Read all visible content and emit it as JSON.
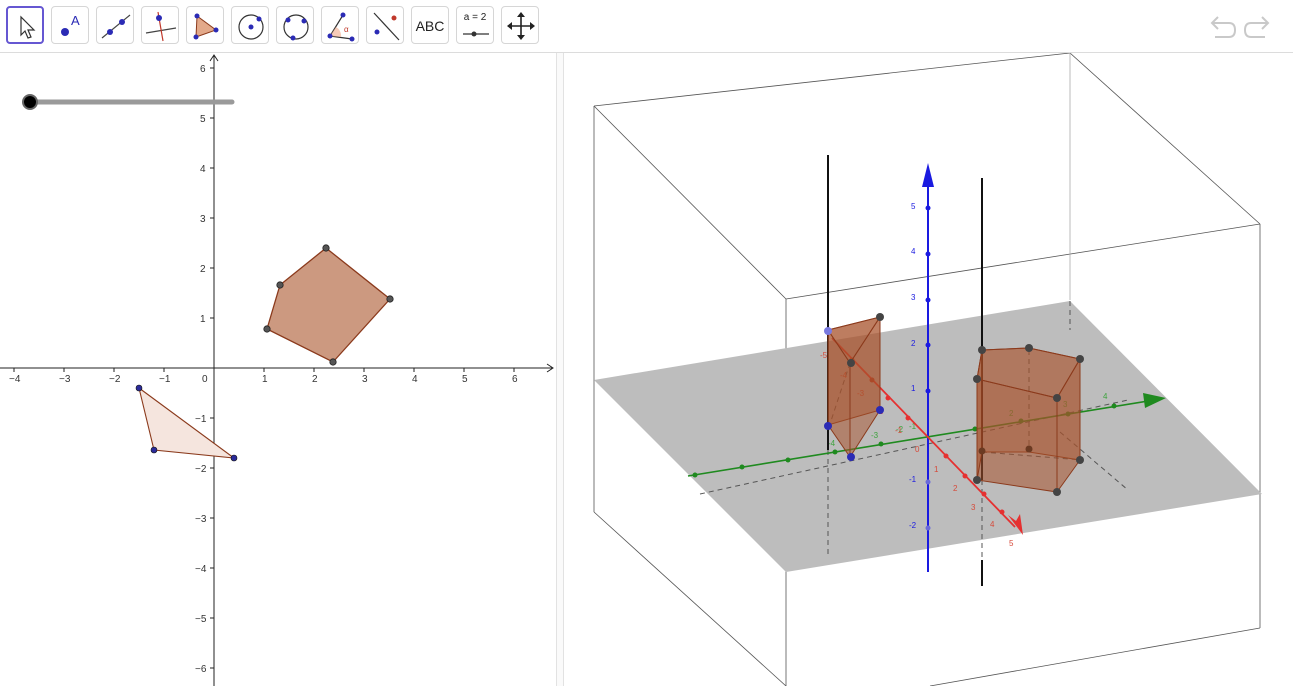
{
  "toolbar": {
    "tools": [
      {
        "name": "move-tool",
        "icon": "arrow-cursor-icon",
        "selected": true
      },
      {
        "name": "point-tool",
        "icon": "point-icon",
        "label": "A"
      },
      {
        "name": "line-tool",
        "icon": "line-through-two-points-icon"
      },
      {
        "name": "perpendicular-line-tool",
        "icon": "perpendicular-line-icon"
      },
      {
        "name": "polygon-tool",
        "icon": "polygon-icon"
      },
      {
        "name": "circle-center-point-tool",
        "icon": "circle-center-point-icon"
      },
      {
        "name": "circle-three-points-tool",
        "icon": "circle-three-points-icon"
      },
      {
        "name": "angle-tool",
        "icon": "angle-icon",
        "label": "α"
      },
      {
        "name": "reflect-about-line-tool",
        "icon": "reflect-about-line-icon"
      },
      {
        "name": "text-tool",
        "icon": "text-icon",
        "label": "ABC"
      },
      {
        "name": "slider-tool",
        "icon": "slider-icon",
        "label": "a = 2"
      },
      {
        "name": "move-graphics-view-tool",
        "icon": "move-graphics-view-icon"
      }
    ],
    "undo_icon": "undo-icon",
    "redo_icon": "redo-icon"
  },
  "graphics_2d": {
    "x_ticks": [
      "−4",
      "−3",
      "−2",
      "−1",
      "0",
      "1",
      "2",
      "3",
      "4",
      "5",
      "6"
    ],
    "y_ticks": [
      "6",
      "5",
      "4",
      "3",
      "2",
      "1",
      "−1",
      "−2",
      "−3",
      "−4",
      "−5",
      "−6"
    ],
    "slider_value": 0,
    "pentagon_fill": "#cc9980",
    "triangle_fill": "#f5e5de",
    "polygon_stroke": "#8b3a1c",
    "point_color": "#2b2b9a"
  },
  "graphics_3d": {
    "x_axis_labels": [
      "5",
      "4",
      "3",
      "2",
      "1",
      "0",
      "-1",
      "-2",
      "-3",
      "-4",
      "-5"
    ],
    "y_axis_labels": [
      "-4",
      "-3",
      "-2",
      "-1",
      "2",
      "3",
      "4"
    ],
    "z_axis_labels": [
      "5",
      "4",
      "3",
      "2",
      "1",
      "-1",
      "-2"
    ],
    "x_axis_color": "#e53030",
    "y_axis_color": "#1f8a1f",
    "z_axis_color": "#1a1ae0",
    "plane_color": "#bdbdbd",
    "prism_color": "#a8522b"
  }
}
